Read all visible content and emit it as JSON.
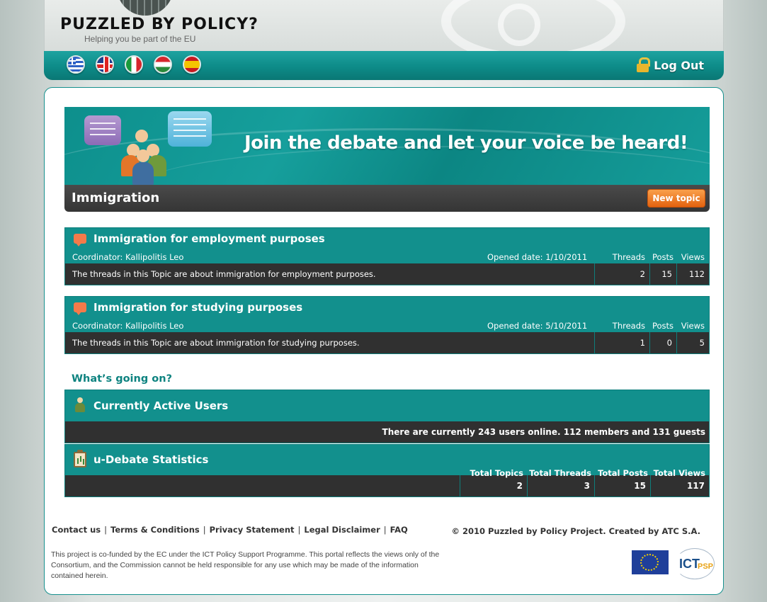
{
  "header": {
    "logo_text": "PUZZLED BY POLICY?",
    "logo_sub": "Helping you be part of the EU",
    "languages": [
      "greek-flag",
      "uk-flag",
      "italy-flag",
      "hungary-flag",
      "spain-flag"
    ],
    "logout_label": "Log Out"
  },
  "banner": {
    "headline": "Join the debate and let your voice be heard!"
  },
  "topic": {
    "title": "Immigration",
    "new_topic_label": "New topic"
  },
  "column_headers": {
    "threads": "Threads",
    "posts": "Posts",
    "views": "Views"
  },
  "topics": [
    {
      "name": "Immigration for employment purposes",
      "coordinator": "Coordinator: Kallipolitis Leo",
      "opened": "Opened date: 1/10/2011",
      "description": "The threads in this Topic are about immigration for employment purposes.",
      "threads": "2",
      "posts": "15",
      "views": "112"
    },
    {
      "name": "Immigration for studying purposes",
      "coordinator": "Coordinator: Kallipolitis Leo",
      "opened": "Opened date: 5/10/2011",
      "description": "The threads in this Topic are about immigration for studying purposes.",
      "threads": "1",
      "posts": "0",
      "views": "5"
    }
  ],
  "whats_going_on": "What’s going on?",
  "active_users": {
    "title": "Currently Active Users",
    "text": "There are currently 243 users online. 112 members and 131 guests"
  },
  "stats": {
    "title": "u-Debate Statistics",
    "headers": [
      "Total Topics",
      "Total Threads",
      "Total Posts",
      "Total Views"
    ],
    "values": [
      "2",
      "3",
      "15",
      "117"
    ]
  },
  "footer": {
    "links": [
      "Contact us",
      "Terms & Conditions",
      "Privacy Statement",
      "Legal Disclaimer",
      "FAQ"
    ],
    "separator": "|",
    "copyright": "© 2010 Puzzled by Policy Project. Created by ATC S.A.",
    "disclaimer": "This project is co-funded by the EC under the ICT Policy Support Programme. This portal reflects the views only of the Consortium, and the Commission cannot be held responsible for any use which may be made of the information contained herein.",
    "ict_text": "ICT",
    "psp_text": "PSP"
  }
}
